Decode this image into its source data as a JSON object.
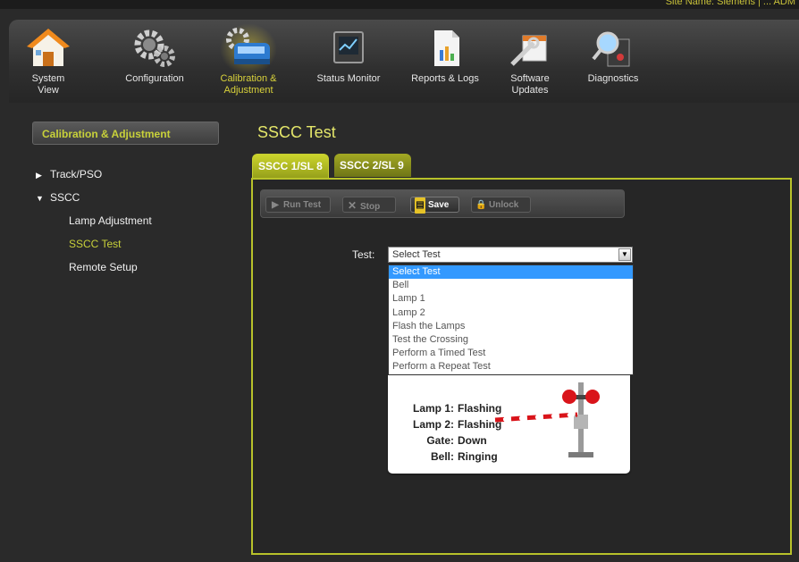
{
  "site": {
    "name": "Site Name: Siemens | ... ADM"
  },
  "toolbar": {
    "tools": [
      {
        "label": "System View",
        "icon": "house-icon"
      },
      {
        "label": "Configuration",
        "icon": "gears-icon"
      },
      {
        "label": "Calibration &\nAdjustment",
        "icon": "train-gears-icon",
        "active": true
      },
      {
        "label": "Status Monitor",
        "icon": "monitor-icon"
      },
      {
        "label": "Reports & Logs",
        "icon": "report-icon"
      },
      {
        "label": "Software\nUpdates",
        "icon": "software-update-icon"
      },
      {
        "label": "Diagnostics",
        "icon": "diagnostics-icon"
      }
    ]
  },
  "sidebar": {
    "header": "Calibration & Adjustment",
    "items": [
      {
        "label": "Track/PSO",
        "expanded": false
      },
      {
        "label": "SSCC",
        "expanded": true
      },
      {
        "label": "Lamp Adjustment"
      },
      {
        "label": "SSCC Test",
        "active": true
      },
      {
        "label": "Remote Setup"
      }
    ]
  },
  "main": {
    "title": "SSCC Test",
    "tabs": [
      {
        "label": "SSCC 1/SL 8",
        "active": true
      },
      {
        "label": "SSCC 2/SL 9"
      }
    ],
    "actions": {
      "run_test": "Run Test",
      "stop": "Stop",
      "save": "Save",
      "unlock": "Unlock"
    },
    "test_label": "Test:",
    "select_value": "Select Test",
    "options": [
      "Select Test",
      "Bell",
      "Lamp 1",
      "Lamp 2",
      "Flash the Lamps",
      "Test the Crossing",
      "Perform a Timed Test",
      "Perform a Repeat Test"
    ],
    "status": {
      "lamp1_key": "Lamp 1:",
      "lamp1_val": "Flashing",
      "lamp2_key": "Lamp 2:",
      "lamp2_val": "Flashing",
      "gate_key": "Gate:",
      "gate_val": "Down",
      "bell_key": "Bell:",
      "bell_val": "Ringing"
    }
  },
  "colors": {
    "accent": "#c8d13a",
    "selected_option": "#3399ff",
    "lamp_red": "#d9141a"
  }
}
